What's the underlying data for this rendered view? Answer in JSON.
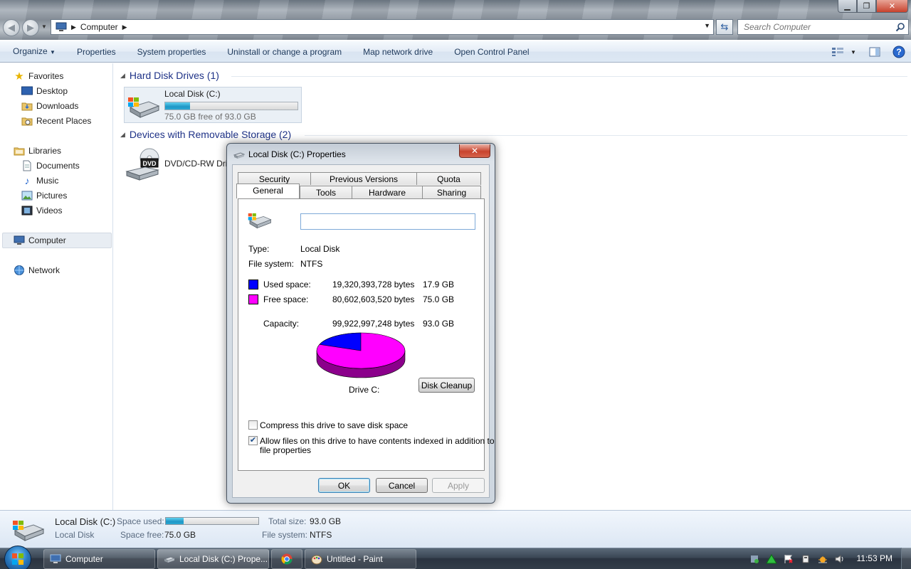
{
  "address": {
    "crumb": "Computer"
  },
  "search": {
    "placeholder": "Search Computer"
  },
  "toolbar": {
    "organize": "Organize",
    "properties": "Properties",
    "system_properties": "System properties",
    "uninstall": "Uninstall or change a program",
    "map_drive": "Map network drive",
    "control_panel": "Open Control Panel"
  },
  "nav": {
    "favorites": "Favorites",
    "desktop": "Desktop",
    "downloads": "Downloads",
    "recent": "Recent Places",
    "libraries": "Libraries",
    "documents": "Documents",
    "music": "Music",
    "pictures": "Pictures",
    "videos": "Videos",
    "computer": "Computer",
    "network": "Network"
  },
  "content": {
    "hdd_header": "Hard Disk Drives (1)",
    "local_disk_name": "Local Disk (C:)",
    "local_disk_free": "75.0 GB free of 93.0 GB",
    "local_disk_used_fraction": 0.19,
    "removable_header": "Devices with Removable Storage (2)",
    "dvd_name": "DVD/CD-RW Driv",
    "dvd_icon_text": "DVD"
  },
  "details": {
    "name": "Local Disk (C:)",
    "type": "Local Disk",
    "space_used_label": "Space used:",
    "space_free_label": "Space free:",
    "space_free_value": "75.0 GB",
    "total_size_label": "Total size:",
    "total_size_value": "93.0 GB",
    "file_system_label": "File system:",
    "file_system_value": "NTFS"
  },
  "dialog": {
    "title": "Local Disk (C:) Properties",
    "tabs_back": [
      "Security",
      "Previous Versions",
      "Quota"
    ],
    "tabs_front": [
      "General",
      "Tools",
      "Hardware",
      "Sharing"
    ],
    "name_value": "",
    "type_label": "Type:",
    "type_value": "Local Disk",
    "fs_label": "File system:",
    "fs_value": "NTFS",
    "used_label": "Used space:",
    "used_bytes": "19,320,393,728 bytes",
    "used_gb": "17.9 GB",
    "free_label": "Free space:",
    "free_bytes": "80,602,603,520 bytes",
    "free_gb": "75.0 GB",
    "capacity_label": "Capacity:",
    "capacity_bytes": "99,922,997,248 bytes",
    "capacity_gb": "93.0 GB",
    "drive_label": "Drive C:",
    "disk_cleanup": "Disk Cleanup",
    "compress_label": "Compress this drive to save disk space",
    "compress_checked": false,
    "index_label_1": "Allow files on this drive to have contents indexed in addition to",
    "index_label_2": "file properties",
    "index_checked": true,
    "ok": "OK",
    "cancel": "Cancel",
    "apply": "Apply",
    "used_color": "#0000ff",
    "free_color": "#ff00ff"
  },
  "taskbar": {
    "computer": "Computer",
    "properties": "Local Disk (C:) Prope...",
    "paint": "Untitled - Paint",
    "clock": "11:53 PM"
  }
}
